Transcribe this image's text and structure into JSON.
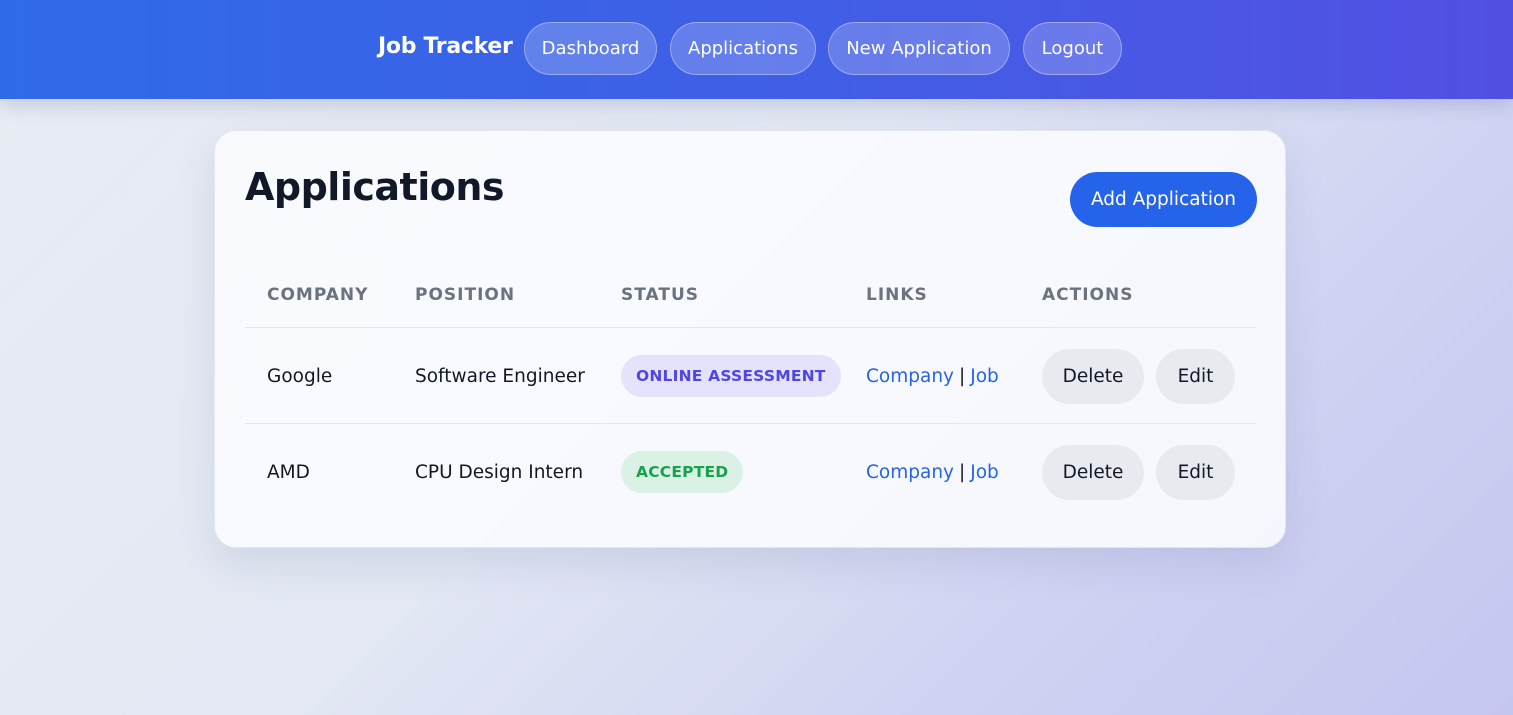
{
  "nav": {
    "brand": "Job Tracker",
    "items": [
      {
        "label": "Dashboard"
      },
      {
        "label": "Applications"
      },
      {
        "label": "New Application"
      },
      {
        "label": "Logout"
      }
    ]
  },
  "main": {
    "title": "Applications",
    "add_button": "Add Application",
    "columns": [
      "COMPANY",
      "POSITION",
      "STATUS",
      "LINKS",
      "ACTIONS"
    ],
    "rows": [
      {
        "company": "Google",
        "position": "Software Engineer",
        "status": "ONLINE ASSESSMENT",
        "status_bg": "#e4e3fb",
        "status_color": "#4f46e5",
        "link_company": "Company",
        "link_sep": "|",
        "link_job": "Job",
        "delete_label": "Delete",
        "edit_label": "Edit"
      },
      {
        "company": "AMD",
        "position": "CPU Design Intern",
        "status": "ACCEPTED",
        "status_bg": "#dcf1e6",
        "status_color": "#16a34a",
        "link_company": "Company",
        "link_sep": "|",
        "link_job": "Job",
        "delete_label": "Delete",
        "edit_label": "Edit"
      }
    ]
  },
  "colors": {
    "accent": "#2563eb",
    "header_gradient_start": "#2f6be8",
    "header_gradient_end": "#5250e3"
  }
}
